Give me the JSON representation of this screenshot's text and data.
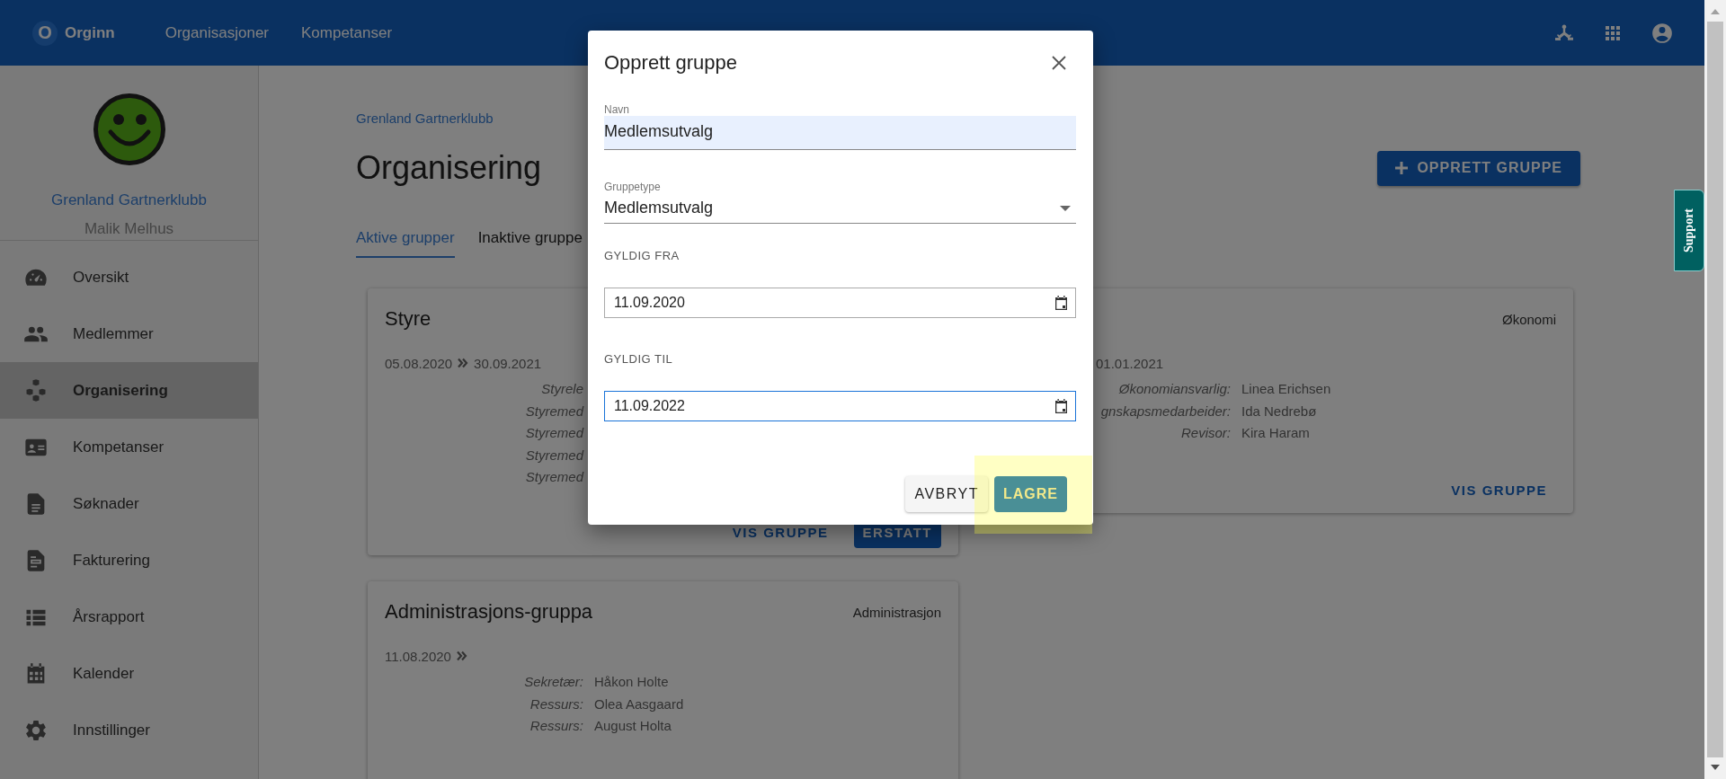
{
  "topbar": {
    "logo_letter": "O",
    "brand": "Orginn",
    "nav": [
      "Organisasjoner",
      "Kompetanser"
    ]
  },
  "sidebar": {
    "org_name": "Grenland Gartnerklubb",
    "user_name": "Malik Melhus",
    "items": [
      {
        "label": "Oversikt",
        "selected": false
      },
      {
        "label": "Medlemmer",
        "selected": false
      },
      {
        "label": "Organisering",
        "selected": true
      },
      {
        "label": "Kompetanser",
        "selected": false
      },
      {
        "label": "Søknader",
        "selected": false
      },
      {
        "label": "Fakturering",
        "selected": false
      },
      {
        "label": "Årsrapport",
        "selected": false
      },
      {
        "label": "Kalender",
        "selected": false
      },
      {
        "label": "Innstillinger",
        "selected": false
      }
    ]
  },
  "page": {
    "breadcrumb": "Grenland Gartnerklubb",
    "title": "Organisering",
    "create_button": "OPPRETT GRUPPE",
    "tabs": [
      {
        "label": "Aktive grupper",
        "selected": true
      },
      {
        "label": "Inaktive gruppe",
        "selected": false
      }
    ]
  },
  "cards": [
    {
      "title": "Styre",
      "start": "05.08.2020",
      "end": "30.09.2021",
      "roles": [
        {
          "role": "Styrele"
        },
        {
          "role": "Styremed"
        },
        {
          "role": "Styremed"
        },
        {
          "role": "Styremed"
        },
        {
          "role": "Styremed"
        }
      ],
      "buttons": [
        {
          "label": "VIS GRUPPE",
          "kind": "text"
        },
        {
          "label": "ERSTATT",
          "kind": "filled"
        }
      ]
    },
    {
      "category": "Økonomi",
      "end": "01.01.2021",
      "roles": [
        {
          "role": "Økonomiansvarlig:",
          "person": "Linea Erichsen"
        },
        {
          "role": "gnskapsmedarbeider:",
          "person": "Ida Nedrebø"
        },
        {
          "role": "Revisor:",
          "person": "Kira Haram"
        }
      ],
      "buttons": [
        {
          "label": "VIS GRUPPE",
          "kind": "text"
        }
      ]
    },
    {
      "title": "Administrasjons-gruppa",
      "category": "Administrasjon",
      "start": "11.08.2020",
      "roles": [
        {
          "role": "Sekretær:",
          "person": "Håkon Holte"
        },
        {
          "role": "Ressurs:",
          "person": "Olea Aasgaard"
        },
        {
          "role": "Ressurs:",
          "person": "August Holta"
        }
      ]
    }
  ],
  "dialog": {
    "title": "Opprett gruppe",
    "name_label": "Navn",
    "name_value": "Medlemsutvalg",
    "type_label": "Gruppetype",
    "type_value": "Medlemsutvalg",
    "from_label": "GYLDIG FRA",
    "from_value": "11.09.2020",
    "to_label": "GYLDIG TIL",
    "to_value": "11.09.2022",
    "to_focused": true,
    "cancel": "AVBRYT",
    "save": "LAGRE",
    "save_highlighted": true
  },
  "support_tab": "Support"
}
